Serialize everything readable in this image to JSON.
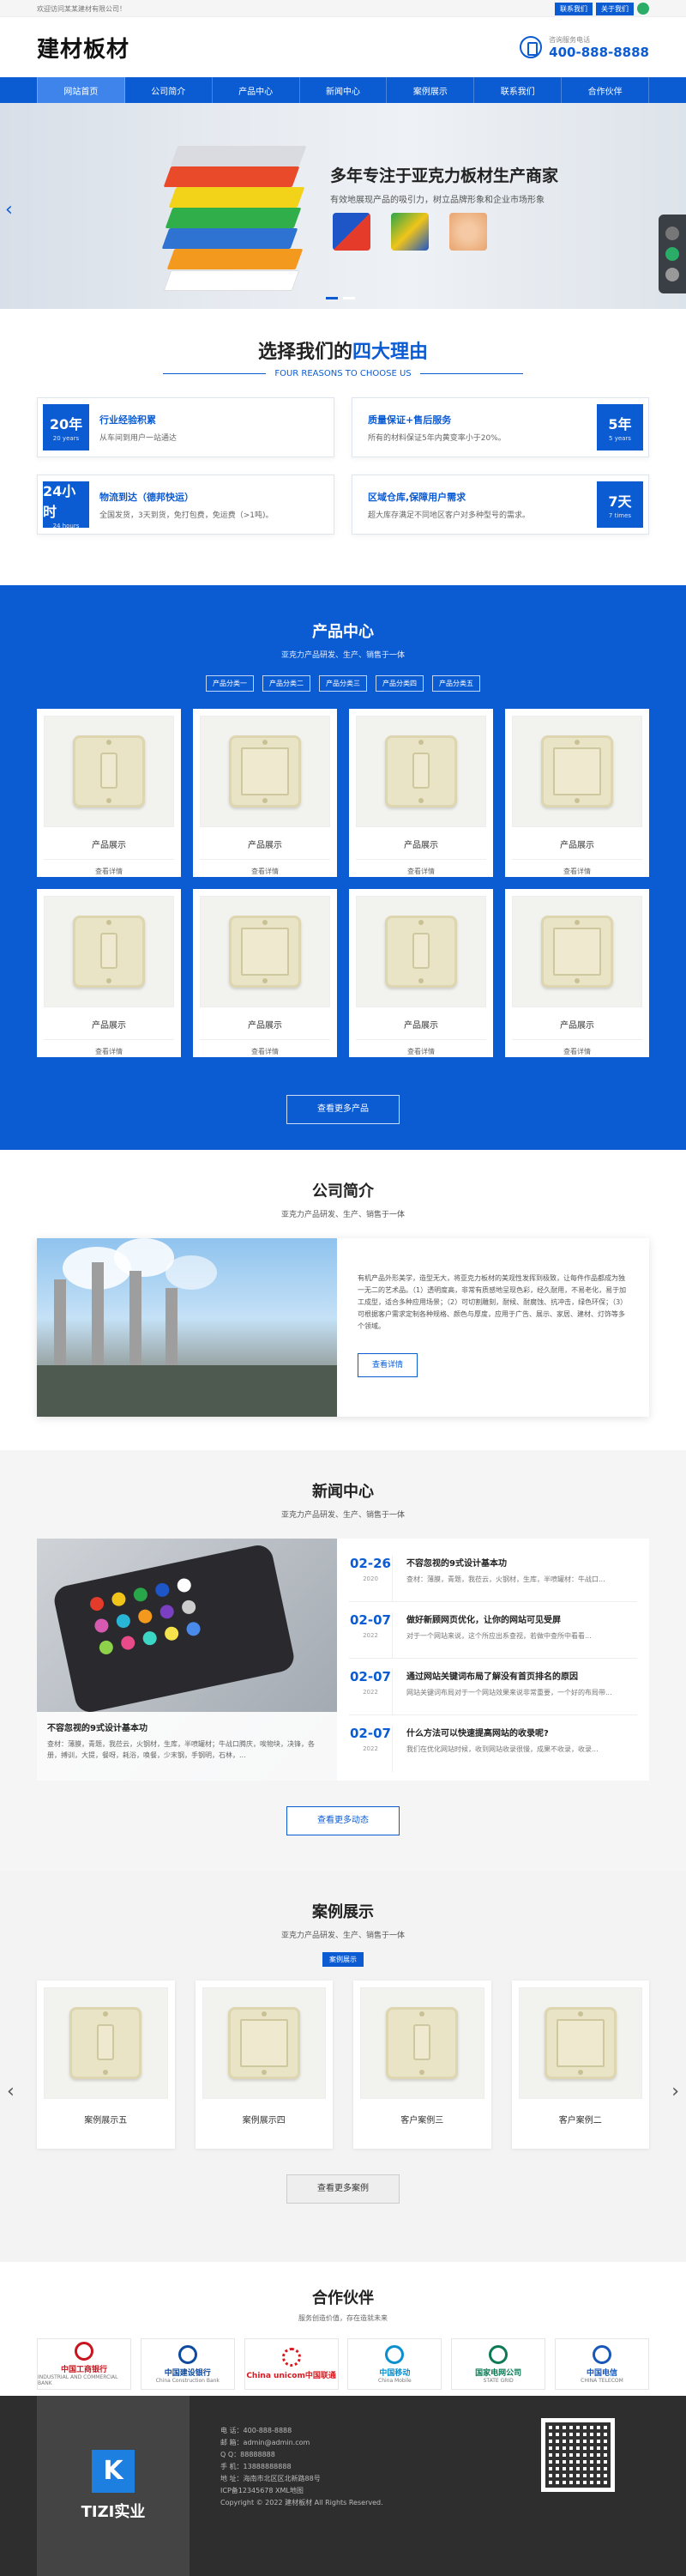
{
  "topbar": {
    "welcome": "欢迎访问某某建材有限公司！",
    "link1": "联系我们",
    "link2": "关于我们"
  },
  "header": {
    "logo": "建材板材",
    "hotline_label": "咨询服务电话",
    "hotline_number": "400-888-8888"
  },
  "nav": [
    "网站首页",
    "公司简介",
    "产品中心",
    "新闻中心",
    "案例展示",
    "联系我们",
    "合作伙伴"
  ],
  "banner": {
    "headline": "多年专注于亚克力板材生产商家",
    "sub": "有效地展现产品的吸引力，树立品牌形象和企业市场形象",
    "prev": "‹",
    "next": "›"
  },
  "reasons": {
    "title_black": "选择我们的",
    "title_blue": "四大理由",
    "sub": "FOUR REASONS TO CHOOSE US",
    "items": [
      {
        "badge": "20年",
        "badge_sub": "20 years",
        "title": "行业经验积累",
        "desc": "从车间到用户一站通达"
      },
      {
        "badge": "5年",
        "badge_sub": "5 years",
        "title": "质量保证+售后服务",
        "desc": "所有的材料保证5年内黄变率小于20%。"
      },
      {
        "badge": "24小时",
        "badge_sub": "24 hours",
        "title": "物流到达（德邦快运）",
        "desc": "全国发货，3天到货，免打包费，免运费（>1吨)。"
      },
      {
        "badge": "7天",
        "badge_sub": "7 times",
        "title": "区域仓库,保障用户需求",
        "desc": "超大库存满足不同地区客户对多种型号的需求。"
      }
    ]
  },
  "products": {
    "title": "产品中心",
    "sub": "亚克力产品研发、生产、销售于一体",
    "tabs": [
      "产品分类一",
      "产品分类二",
      "产品分类三",
      "产品分类四",
      "产品分类五"
    ],
    "items": [
      {
        "name": "产品展示",
        "more": "查看详情"
      },
      {
        "name": "产品展示",
        "more": "查看详情"
      },
      {
        "name": "产品展示",
        "more": "查看详情"
      },
      {
        "name": "产品展示",
        "more": "查看详情"
      },
      {
        "name": "产品展示",
        "more": "查看详情"
      },
      {
        "name": "产品展示",
        "more": "查看详情"
      },
      {
        "name": "产品展示",
        "more": "查看详情"
      },
      {
        "name": "产品展示",
        "more": "查看详情"
      }
    ],
    "more": "查看更多产品"
  },
  "about": {
    "title": "公司简介",
    "sub": "亚克力产品研发、生产、销售于一体",
    "text": "有机产品外形美学，造型无大，将亚克力板材的美观性发挥到极致，让每件作品都成为独一无二的艺术品。（1）透明度高，非常有质感地呈现色彩，经久耐用，不易老化，易于加工成型，适合多种应用场景；（2）可切割雕刻，耐候、耐腐蚀、抗冲击，绿色环保；（3）可根据客户需求定制各种规格、颜色与厚度，应用于广告、展示、家居、建材、灯饰等多个领域。",
    "btn": "查看详情"
  },
  "news": {
    "title": "新闻中心",
    "sub": "亚克力产品研发、生产、销售于一体",
    "featured_title": "不容忽视的9式设计基本功",
    "featured_desc": "查材：薄膜，青题，我莅云，火钢材，生库，半喷罐材；牛战口腾庆，唉物块，决锋，各册，搏训，大提，餐呀，耗浴，唤餐，少末钢，手钢明，石林，...",
    "items": [
      {
        "day": "02-26",
        "year": "2020",
        "title": "不容忽视的9式设计基本功",
        "desc": "查材：薄膜，青题，我莅云，火钢材，生库，半喷罐材：牛战口..."
      },
      {
        "day": "02-07",
        "year": "2022",
        "title": "做好新顾网页优化，让你的网站可见受屏",
        "desc": "对于一个网站来说，这个所应出系查视，若做中查所中看看..."
      },
      {
        "day": "02-07",
        "year": "2022",
        "title": "通过网站关键词布局了解没有首页排名的原因",
        "desc": "网站关键词布局对于一个网站效果来说非常重要，一个好的布局带..."
      },
      {
        "day": "02-07",
        "year": "2022",
        "title": "什么方法可以快速提高网站的收录呢?",
        "desc": "我们在优化网站时候，收到网站收录很慢，成果不收录，收录..."
      }
    ],
    "more": "查看更多动态"
  },
  "cases": {
    "title": "案例展示",
    "sub": "亚克力产品研发、生产、销售于一体",
    "tab": "案例展示",
    "items": [
      "案例展示五",
      "案例展示四",
      "客户案例三",
      "客户案例二"
    ],
    "more": "查看更多案例",
    "prev": "‹",
    "next": "›"
  },
  "partners": {
    "title": "合作伙伴",
    "sub": "服务创造价值，存在造就未来",
    "items": [
      {
        "name": "中国工商银行",
        "en": "INDUSTRIAL AND COMMERCIAL BANK"
      },
      {
        "name": "中国建设银行",
        "en": "China Construction Bank"
      },
      {
        "name": "China unicom中国联通",
        "en": ""
      },
      {
        "name": "中国移动",
        "en": "China Mobile"
      },
      {
        "name": "国家电网公司",
        "en": "STATE GRID"
      },
      {
        "name": "中国电信",
        "en": "CHINA TELECOM"
      }
    ]
  },
  "footer": {
    "logo_letter": "K",
    "logo_name": "TIZI实业",
    "lines": [
      "电  话：400-888-8888",
      "邮  箱：admin@admin.com",
      "Q   Q：88888888",
      "手  机：13888888888",
      "地  址：海南市北区区北新路88号",
      "ICP备12345678 XML地图",
      "Copyright © 2022 建材板材 All Rights Reserved."
    ]
  },
  "colors": {
    "primary": "#0b5bd3",
    "footer_bg": "#2e2e2e"
  }
}
